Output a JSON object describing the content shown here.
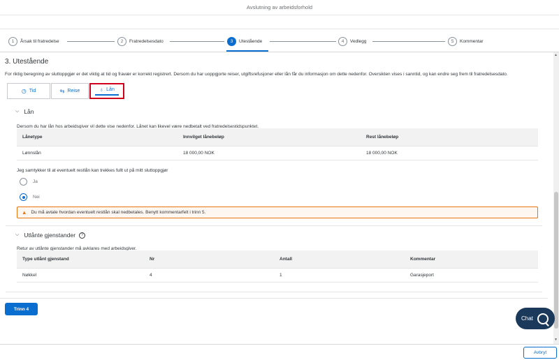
{
  "header": {
    "title": "Avslutning av arbeidsforhold"
  },
  "stepper": {
    "steps": [
      {
        "number": "1",
        "label": "Årsak til fratredelse"
      },
      {
        "number": "2",
        "label": "Fratredelsesdato"
      },
      {
        "number": "3",
        "label": "Utestående"
      },
      {
        "number": "4",
        "label": "Vedlegg"
      },
      {
        "number": "5",
        "label": "Kommentar"
      }
    ],
    "active_index": 3
  },
  "section": {
    "title": "3. Utestående",
    "description": "For riktig beregning av sluttoppgjør er det viktig at tid og fravær er korrekt registrert. Dersom du har uoppgjorte reiser, utgiftsrefusjoner eller lån får du informasjon om dette nedenfor. Oversikten vises i sanntid, og kan endre seg frem til fratredelsesdato."
  },
  "tabs": [
    {
      "label": "Tid",
      "icon": "clock-icon",
      "glyph": "◷"
    },
    {
      "label": "Reise",
      "icon": "travel-icon",
      "glyph": "⇆"
    },
    {
      "label": "Lån",
      "icon": "money-bag-icon",
      "glyph": "♁"
    }
  ],
  "loan": {
    "title": "Lån",
    "description": "Dersom du har lån hos arbeidsgiver vil dette vise nedenfor. Lånet kan likevel være nedbetalt ved fratredelsestidspunktet.",
    "columns": [
      "Lånetype",
      "Innvilget lånebeløp",
      "Rest lånebeløp"
    ],
    "rows": [
      [
        "Lønnslån",
        "18 000,00 NOK",
        "18 000,00 NOK"
      ]
    ],
    "consent_question": "Jeg samtykker til at eventuelt restlån kan trekkes fullt ut på mitt sluttoppgjør",
    "options": [
      "Ja",
      "Nei"
    ],
    "selected_option": "Nei",
    "warning": "Du må avtale hvordan eventuelt restlån skal nedbetales. Benytt kommentarfelt i trinn 5."
  },
  "items": {
    "title": "Utlånte gjenstander",
    "description": "Retur av utlånte gjenstander må avklares med arbeidsgiver.",
    "columns": [
      "Type utlånt gjenstand",
      "Nr",
      "Antall",
      "Kommentar"
    ],
    "rows": [
      [
        "Nøkkel",
        "4",
        "1",
        "Garasjeport"
      ]
    ]
  },
  "actions": {
    "next_label": "Trinn 4",
    "cancel_label": "Avbryt",
    "chat_label": "Chat"
  },
  "colors": {
    "primary": "#0a6ed1",
    "warning": "#e9730c",
    "highlight": "#d0021b",
    "chat": "#1b3a5b"
  }
}
